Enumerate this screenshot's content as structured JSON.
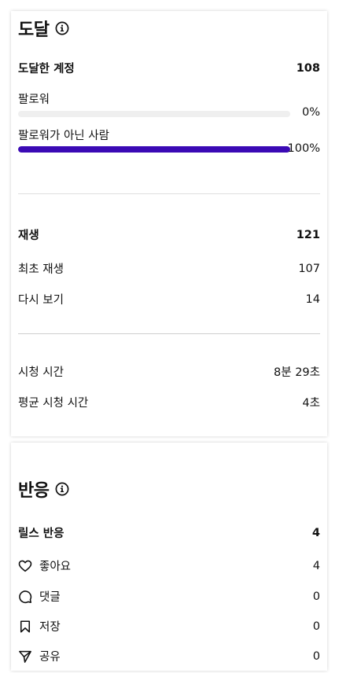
{
  "reach": {
    "title": "도달",
    "accounts_reached_label": "도달한 계정",
    "accounts_reached_value": "108",
    "followers_label": "팔로워",
    "followers_pct_label": "0%",
    "followers_pct": 0,
    "non_followers_label": "팔로워가 아닌 사람",
    "non_followers_pct_label": "100%",
    "non_followers_pct": 100
  },
  "plays": {
    "label": "재생",
    "value": "121",
    "initial_plays_label": "최초 재생",
    "initial_plays_value": "107",
    "replays_label": "다시 보기",
    "replays_value": "14"
  },
  "watch": {
    "watch_time_label": "시청 시간",
    "watch_time_value": "8분 29초",
    "avg_watch_time_label": "평균 시청 시간",
    "avg_watch_time_value": "4초"
  },
  "engagement": {
    "title": "반응",
    "reels_interactions_label": "릴스 반응",
    "reels_interactions_value": "4",
    "likes_label": "좋아요",
    "likes_value": "4",
    "comments_label": "댓글",
    "comments_value": "0",
    "saves_label": "저장",
    "saves_value": "0",
    "shares_label": "공유",
    "shares_value": "0"
  },
  "icons": {
    "info": "info-icon",
    "like": "heart-icon",
    "comment": "comment-bubble-icon",
    "save": "bookmark-icon",
    "share": "paper-plane-icon"
  },
  "colors": {
    "accent_bar": "#3b0ab5",
    "track": "#efefef",
    "text": "#111111",
    "divider": "#dedede"
  }
}
